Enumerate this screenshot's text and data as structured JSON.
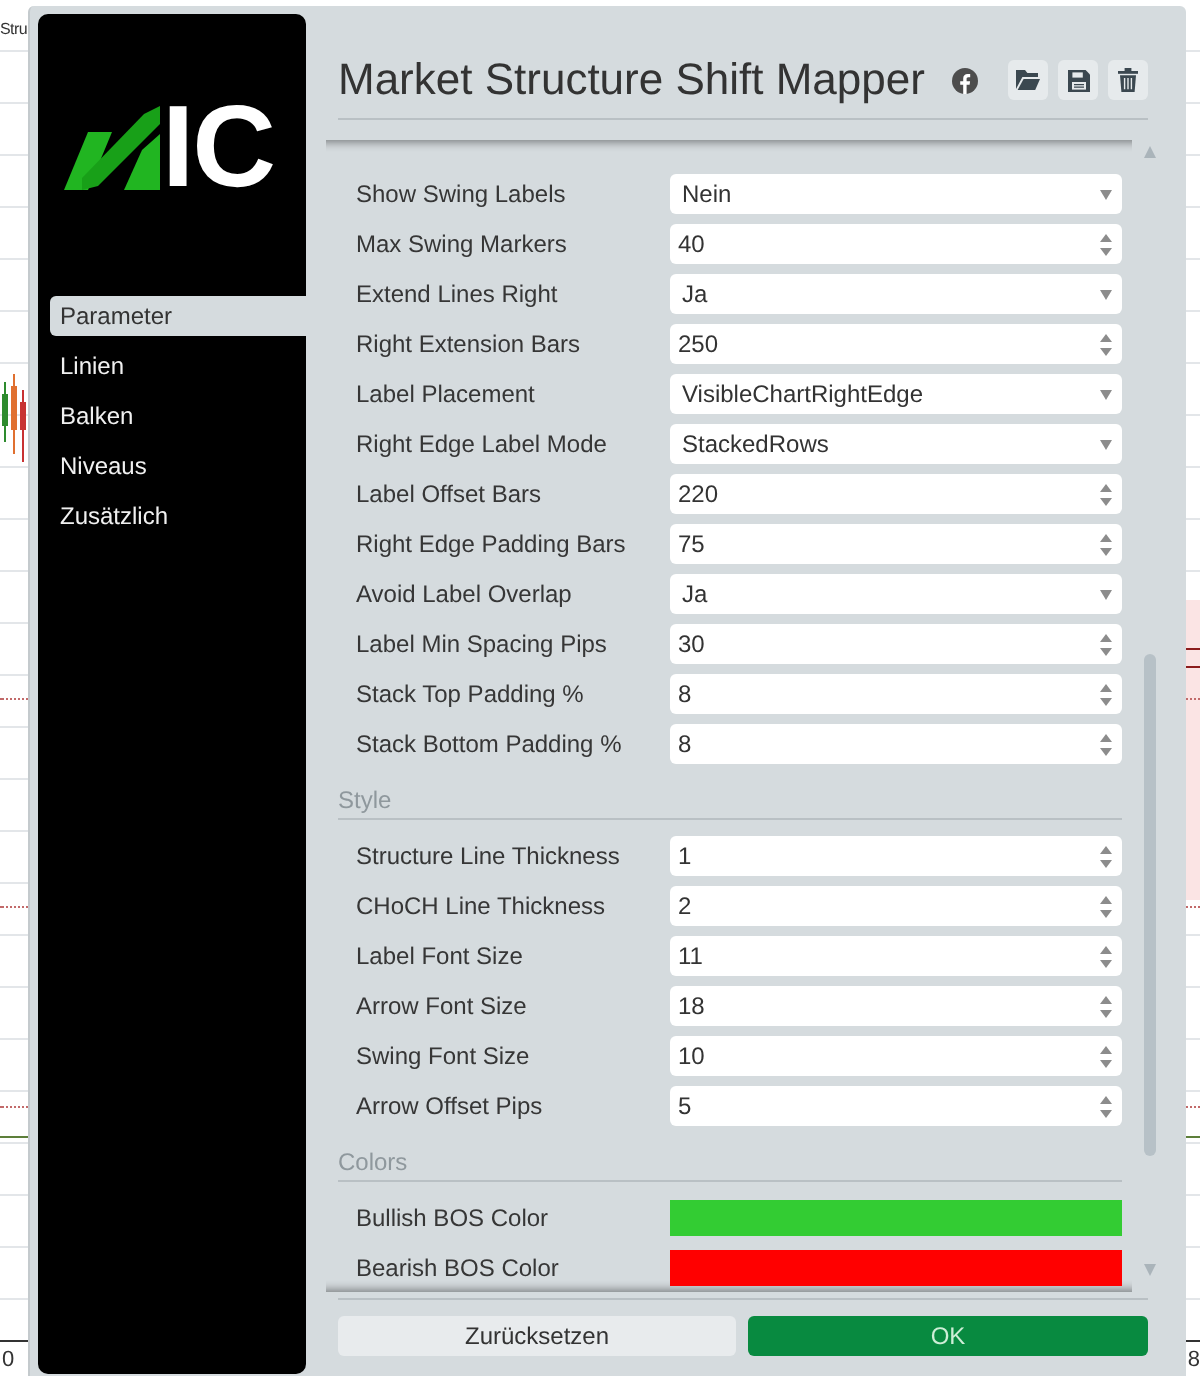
{
  "chart": {
    "title": "Stru",
    "axis_labels": [
      "0",
      "8"
    ]
  },
  "sidebar": {
    "logo": "IC",
    "items": [
      {
        "label": "Parameter",
        "selected": true
      },
      {
        "label": "Linien",
        "selected": false
      },
      {
        "label": "Balken",
        "selected": false
      },
      {
        "label": "Niveaus",
        "selected": false
      },
      {
        "label": "Zusätzlich",
        "selected": false
      }
    ]
  },
  "dialog": {
    "title": "Market Structure Shift Mapper"
  },
  "sections": [
    {
      "rows": [
        {
          "label": "Show Swing Labels",
          "kind": "select",
          "value": "Nein"
        },
        {
          "label": "Max Swing Markers",
          "kind": "number",
          "value": "40"
        },
        {
          "label": "Extend Lines Right",
          "kind": "select",
          "value": "Ja"
        },
        {
          "label": "Right Extension Bars",
          "kind": "number",
          "value": "250"
        },
        {
          "label": "Label Placement",
          "kind": "select",
          "value": "VisibleChartRightEdge"
        },
        {
          "label": "Right Edge Label Mode",
          "kind": "select",
          "value": "StackedRows"
        },
        {
          "label": "Label Offset Bars",
          "kind": "number",
          "value": "220"
        },
        {
          "label": "Right Edge Padding Bars",
          "kind": "number",
          "value": "75"
        },
        {
          "label": "Avoid Label Overlap",
          "kind": "select",
          "value": "Ja"
        },
        {
          "label": "Label Min Spacing Pips",
          "kind": "number",
          "value": "30"
        },
        {
          "label": "Stack Top Padding %",
          "kind": "number",
          "value": "8"
        },
        {
          "label": "Stack Bottom Padding %",
          "kind": "number",
          "value": "8"
        }
      ]
    },
    {
      "title": "Style",
      "rows": [
        {
          "label": "Structure Line Thickness",
          "kind": "number",
          "value": "1"
        },
        {
          "label": "CHoCH Line Thickness",
          "kind": "number",
          "value": "2"
        },
        {
          "label": "Label Font Size",
          "kind": "number",
          "value": "11"
        },
        {
          "label": "Arrow Font Size",
          "kind": "number",
          "value": "18"
        },
        {
          "label": "Swing Font Size",
          "kind": "number",
          "value": "10"
        },
        {
          "label": "Arrow Offset Pips",
          "kind": "number",
          "value": "5"
        }
      ]
    },
    {
      "title": "Colors",
      "rows": [
        {
          "label": "Bullish BOS Color",
          "kind": "color",
          "color": "#33cc33"
        },
        {
          "label": "Bearish BOS Color",
          "kind": "color",
          "color": "#ff0000"
        }
      ]
    }
  ],
  "buttons": [
    {
      "label": "Zurücksetzen",
      "kind": "secondary"
    },
    {
      "label": "OK",
      "kind": "primary"
    }
  ]
}
